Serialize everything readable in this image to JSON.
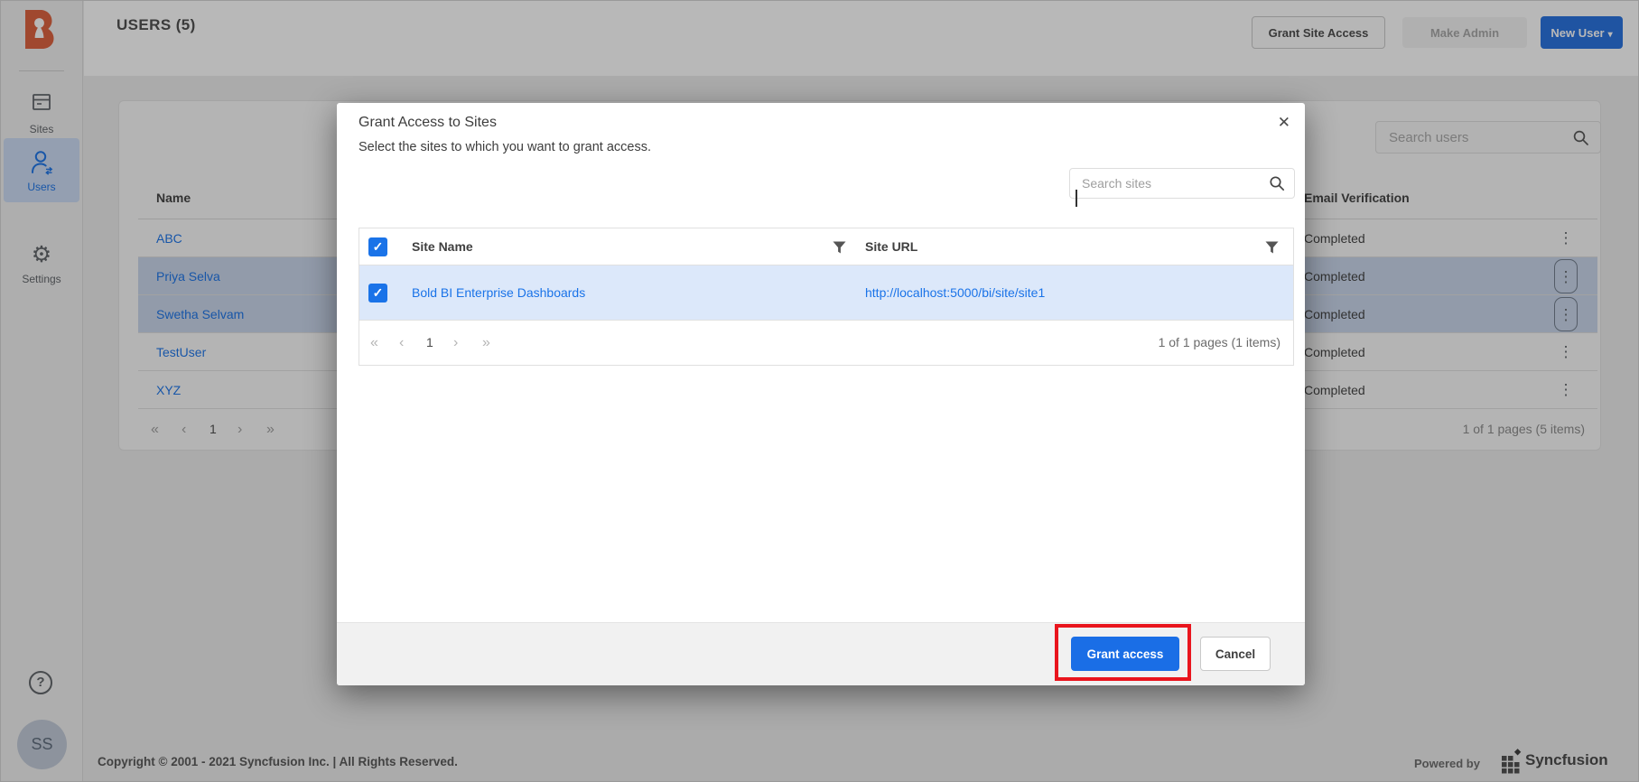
{
  "icons": {
    "close": "✕",
    "caret_down": "▾",
    "kebab": "⋮",
    "help": "?",
    "check": "✓",
    "first_page": "«",
    "prev_page": "‹",
    "next_page": "›",
    "last_page": "»"
  },
  "sidebar": {
    "items": [
      {
        "label": "Sites"
      },
      {
        "label": "Users",
        "active": true
      },
      {
        "label": "Settings"
      }
    ],
    "avatar_initials": "SS"
  },
  "header": {
    "title": "USERS (5)",
    "buttons": {
      "grant_site_access": "Grant Site Access",
      "make_admin": "Make Admin",
      "new_user": "New User"
    }
  },
  "users_panel": {
    "search_placeholder": "Search users",
    "columns": {
      "name": "Name",
      "email_verification": "Email Verification"
    },
    "rows": [
      {
        "name": "ABC",
        "email_verification": "Completed",
        "selected": false
      },
      {
        "name": "Priya Selva",
        "email_verification": "Completed",
        "selected": true
      },
      {
        "name": "Swetha Selvam",
        "email_verification": "Completed",
        "selected": true
      },
      {
        "name": "TestUser",
        "email_verification": "Completed",
        "selected": false
      },
      {
        "name": "XYZ",
        "email_verification": "Completed",
        "selected": false
      }
    ],
    "pager": {
      "page": "1",
      "summary": "1 of 1 pages (5 items)"
    }
  },
  "modal": {
    "title": "Grant Access to Sites",
    "subtitle": "Select the sites to which you want to grant access.",
    "search_placeholder": "Search sites",
    "columns": {
      "site_name": "Site Name",
      "site_url": "Site URL"
    },
    "rows": [
      {
        "site_name": "Bold BI Enterprise Dashboards",
        "site_url": "http://localhost:5000/bi/site/site1",
        "checked": true
      }
    ],
    "pager": {
      "page": "1",
      "summary": "1 of 1 pages (1 items)"
    },
    "buttons": {
      "grant": "Grant access",
      "cancel": "Cancel"
    }
  },
  "footer": {
    "copyright": "Copyright © 2001 - 2021 Syncfusion Inc. | All Rights Reserved.",
    "powered_by": "Powered by",
    "brand": "Syncfusion"
  },
  "colors": {
    "accent_blue": "#1a73e8",
    "logo_orange": "#dd5f3b",
    "selected_row_modal": "#dce8fa",
    "selected_row_table": "#c9d6eb",
    "annotation_red": "#e9151d"
  }
}
